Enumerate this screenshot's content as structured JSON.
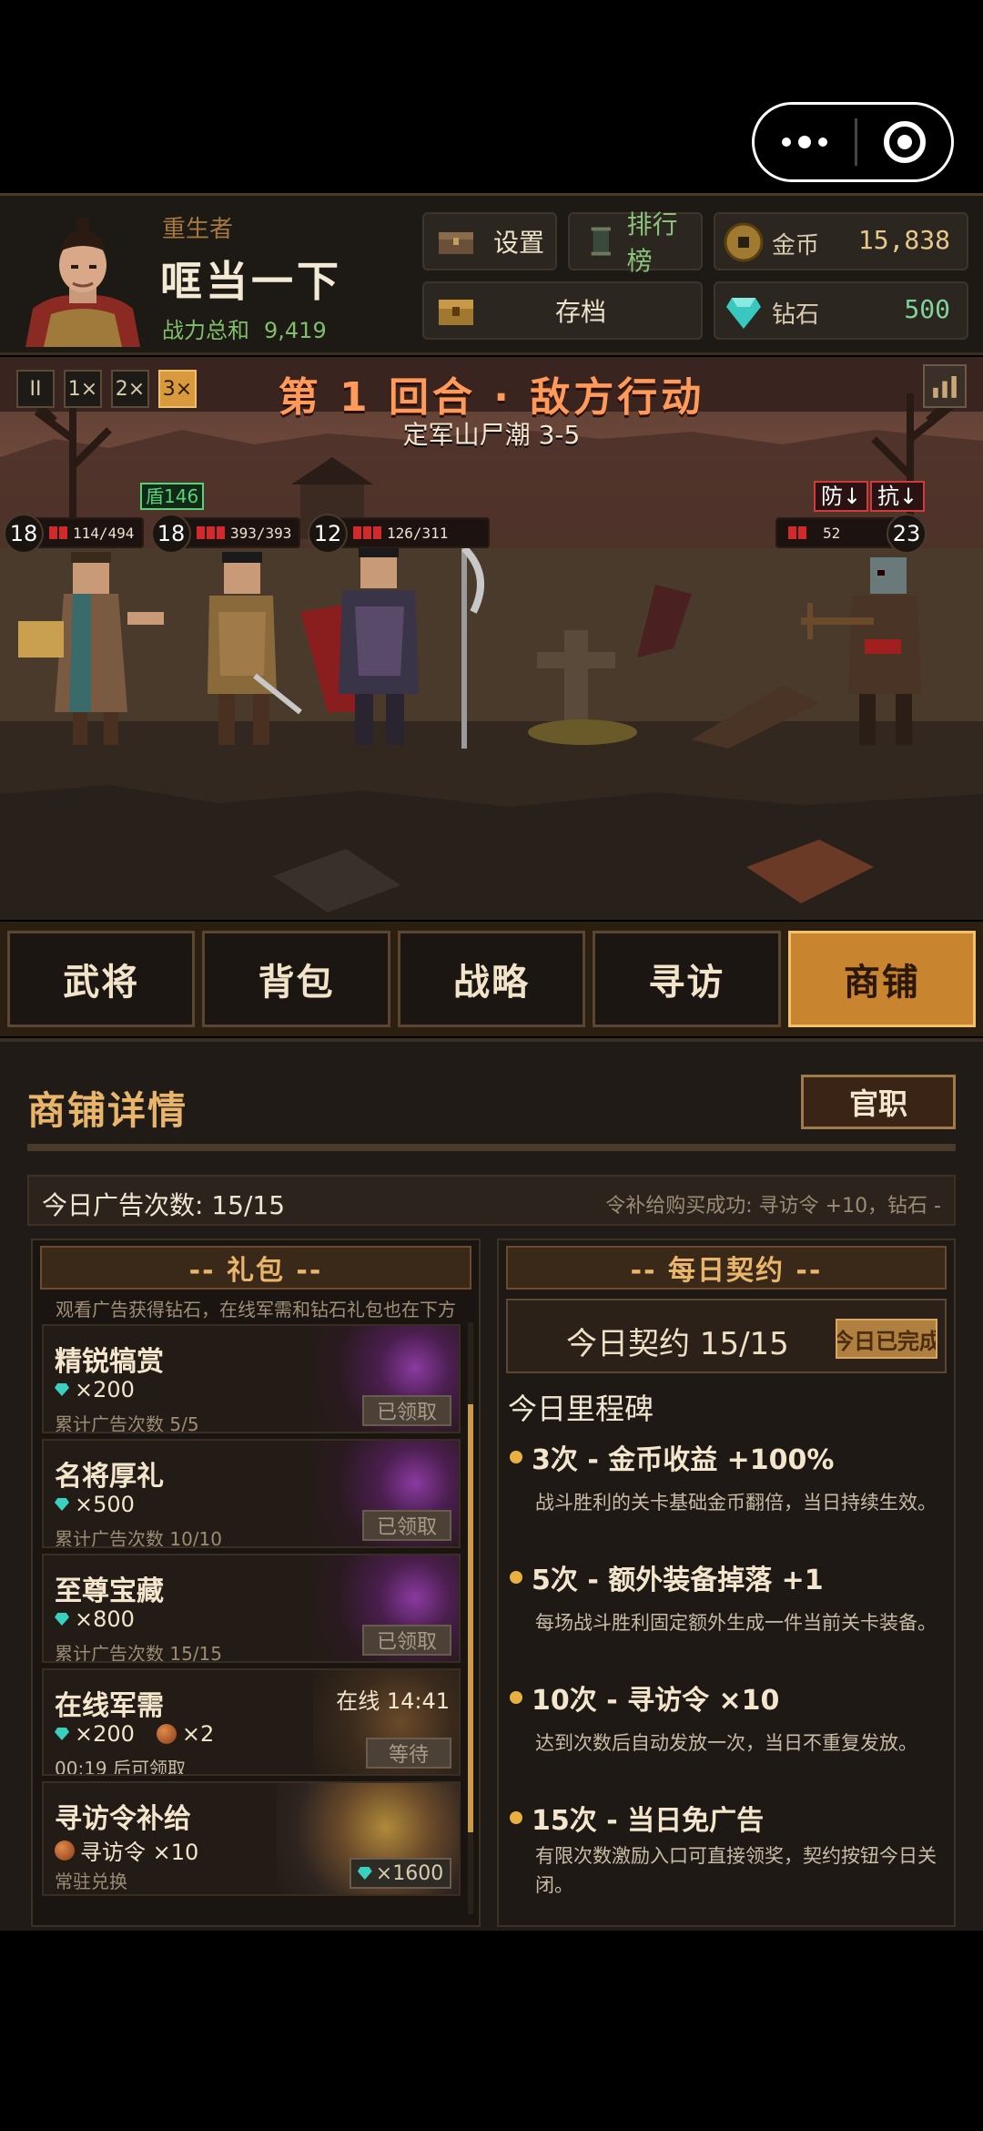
{
  "header": {
    "hero_class": "重生者",
    "hero_name": "哐当一下",
    "power_label": "战力总和",
    "power_value": "9,419",
    "settings_label": "设置",
    "ranking_label": "排行榜",
    "save_label": "存档",
    "gold_label": "金币",
    "gold_value": "15,838",
    "diamond_label": "钻石",
    "diamond_value": "500"
  },
  "battle": {
    "speeds": [
      "II",
      "1×",
      "2×",
      "3×"
    ],
    "active_speed": "3×",
    "round_title": "第 1 回合 · 敌方行动",
    "stage_name": "定军山尸潮 3-5",
    "shield_tag": "盾146",
    "allies": [
      {
        "level": "18",
        "hp": "114/494",
        "hp_fraction": 0.23
      },
      {
        "level": "18",
        "hp": "393/393",
        "hp_fraction": 1.0
      },
      {
        "level": "12",
        "hp": "126/311",
        "hp_fraction": 0.41
      }
    ],
    "enemy": {
      "level": "23",
      "hp": "52",
      "hp_fraction": 0.2
    },
    "enemy_debuffs": [
      "防↓",
      "抗↓"
    ]
  },
  "tabs": [
    {
      "label": "武将",
      "active": false
    },
    {
      "label": "背包",
      "active": false
    },
    {
      "label": "战略",
      "active": false
    },
    {
      "label": "寻访",
      "active": false
    },
    {
      "label": "商铺",
      "active": true
    }
  ],
  "shop": {
    "title": "商铺详情",
    "official_button": "官职",
    "ad_count": "今日广告次数: 15/15",
    "ad_message": "令补给购买成功: 寻访令 +10，钻石 -",
    "gifts_header": "-- 礼包 --",
    "gifts_sub": "观看广告获得钻石，在线军需和钻石礼包也在下方",
    "gifts": [
      {
        "name": "精锐犒赏",
        "reward": "×200",
        "progress": "累计广告次数 5/5",
        "state": "已领取"
      },
      {
        "name": "名将厚礼",
        "reward": "×500",
        "progress": "累计广告次数 10/10",
        "state": "已领取"
      },
      {
        "name": "至尊宝藏",
        "reward": "×800",
        "progress": "累计广告次数 15/15",
        "state": "已领取"
      }
    ],
    "online": {
      "name": "在线军需",
      "status": "在线 14:41",
      "reward_gems": "×200",
      "reward_items": "×2",
      "timer": "00:19 后可领取",
      "state": "等待"
    },
    "token": {
      "name": "寻访令补给",
      "reward": "寻访令 ×10",
      "note": "常驻兑换",
      "price": "×1600"
    },
    "contract_header": "-- 每日契约 --",
    "contract_text": "今日契约 15/15",
    "contract_done": "今日已完成",
    "milestone_title": "今日里程碑",
    "milestones": [
      {
        "title": "3次 - 金币收益 +100%",
        "desc": "战斗胜利的关卡基础金币翻倍，当日持续生效。"
      },
      {
        "title": "5次 - 额外装备掉落 +1",
        "desc": "每场战斗胜利固定额外生成一件当前关卡装备。"
      },
      {
        "title": "10次 - 寻访令 ×10",
        "desc": "达到次数后自动发放一次，当日不重复发放。"
      },
      {
        "title": "15次 - 当日免广告",
        "desc": "有限次数激励入口可直接领奖，契约按钮今日关闭。"
      }
    ]
  }
}
